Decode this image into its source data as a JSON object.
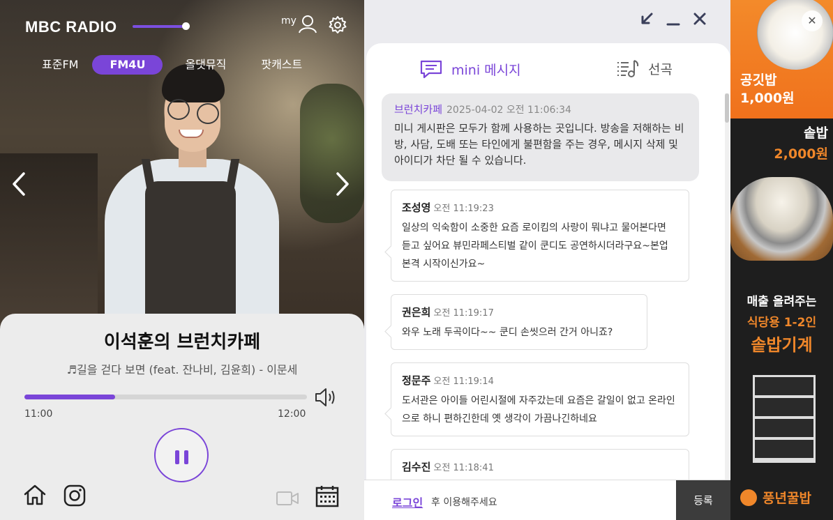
{
  "app": {
    "logo": "MBC RADIO",
    "my_label": "my"
  },
  "channels": [
    "표준FM",
    "FM4U",
    "올댓뮤직",
    "팟캐스트"
  ],
  "active_channel": "FM4U",
  "now_playing": {
    "show_title": "이석훈의 브런치카페",
    "song": "♬길을 걷다 보면 (feat. 잔나비, 김윤희) - 이문세",
    "start_time": "11:00",
    "end_time": "12:00",
    "progress": 0.32
  },
  "mini_tabs": {
    "message": "mini 메시지",
    "songs": "선곡"
  },
  "notice": {
    "nick": "브런치카페",
    "date": "2025-04-02 오전 11:06:34",
    "body": "미니 게시판은 모두가 함께 사용하는 곳입니다. 방송을 저해하는 비방, 사담, 도배 또는 타인에게 불편함을 주는 경우, 메시지 삭제 및 아이디가 차단 될 수 있습니다."
  },
  "messages": [
    {
      "nick": "조성영",
      "time": "오전 11:19:23",
      "body": "일상의 익숙함이 소중한 요즘 로이킴의 사랑이 뭐냐고 물어본다면 듣고 싶어요 뷰민라페스티벌 같이 쿤디도 공연하시더라구요~본업 본격 시작이신가요~"
    },
    {
      "nick": "권은희",
      "time": "오전 11:19:17",
      "body": "와우 노래 두곡이다~~ 쿤디 손씻으러 간거 아니죠?"
    },
    {
      "nick": "정문주",
      "time": "오전 11:19:14",
      "body": "도서관은 아이들 어린시절에 자주갔는데 요즘은 갈일이 없고 온라인으로 하니 편하긴한데 옛 생각이 가끔나긴하네요"
    },
    {
      "nick": "김수진",
      "time": "오전 11:18:41",
      "body": ""
    }
  ],
  "footer": {
    "login_link": "로그인",
    "login_rest": "후 이용해주세요",
    "submit": "등록"
  },
  "ad": {
    "line1a": "공깃밥",
    "line1b": "1,000원",
    "line2a": "솥밥",
    "line2b": "2,000원",
    "line3a": "매출 올려주는",
    "line3b": "식당용 1-2인",
    "line3c": "솥밥기계",
    "brand": "풍년꿀밥",
    "close": "✕"
  },
  "colors": {
    "accent": "#7a45d8",
    "ad_orange": "#f0872a"
  },
  "icons": [
    "user-icon",
    "gear-icon",
    "chevron-left-icon",
    "chevron-right-icon",
    "speaker-icon",
    "pause-icon",
    "home-icon",
    "instagram-icon",
    "video-icon",
    "calendar-icon",
    "chat-icon",
    "playlist-icon",
    "shrink-icon",
    "minimize-icon",
    "close-icon"
  ]
}
